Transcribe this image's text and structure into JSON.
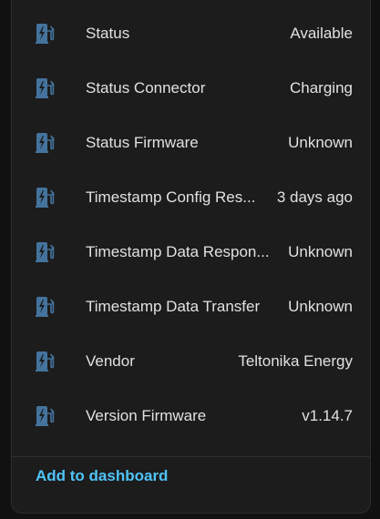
{
  "colors": {
    "card_background": "#1c1c1c",
    "text_primary": "#e1e1e1",
    "icon_color": "#44739e",
    "link_color": "#4fc3f7"
  },
  "entities": [
    {
      "icon": "ev-station-icon",
      "name": "Status",
      "state": "Available"
    },
    {
      "icon": "ev-station-icon",
      "name": "Status Connector",
      "state": "Charging"
    },
    {
      "icon": "ev-station-icon",
      "name": "Status Firmware",
      "state": "Unknown"
    },
    {
      "icon": "ev-station-icon",
      "name": "Timestamp Config Res...",
      "state": "3 days ago"
    },
    {
      "icon": "ev-station-icon",
      "name": "Timestamp Data Respon...",
      "state": "Unknown"
    },
    {
      "icon": "ev-station-icon",
      "name": "Timestamp Data Transfer",
      "state": "Unknown"
    },
    {
      "icon": "ev-station-icon",
      "name": "Vendor",
      "state": "Teltonika Energy"
    },
    {
      "icon": "ev-station-icon",
      "name": "Version Firmware",
      "state": "v1.14.7"
    }
  ],
  "footer": {
    "add_to_dashboard_label": "Add to dashboard"
  }
}
